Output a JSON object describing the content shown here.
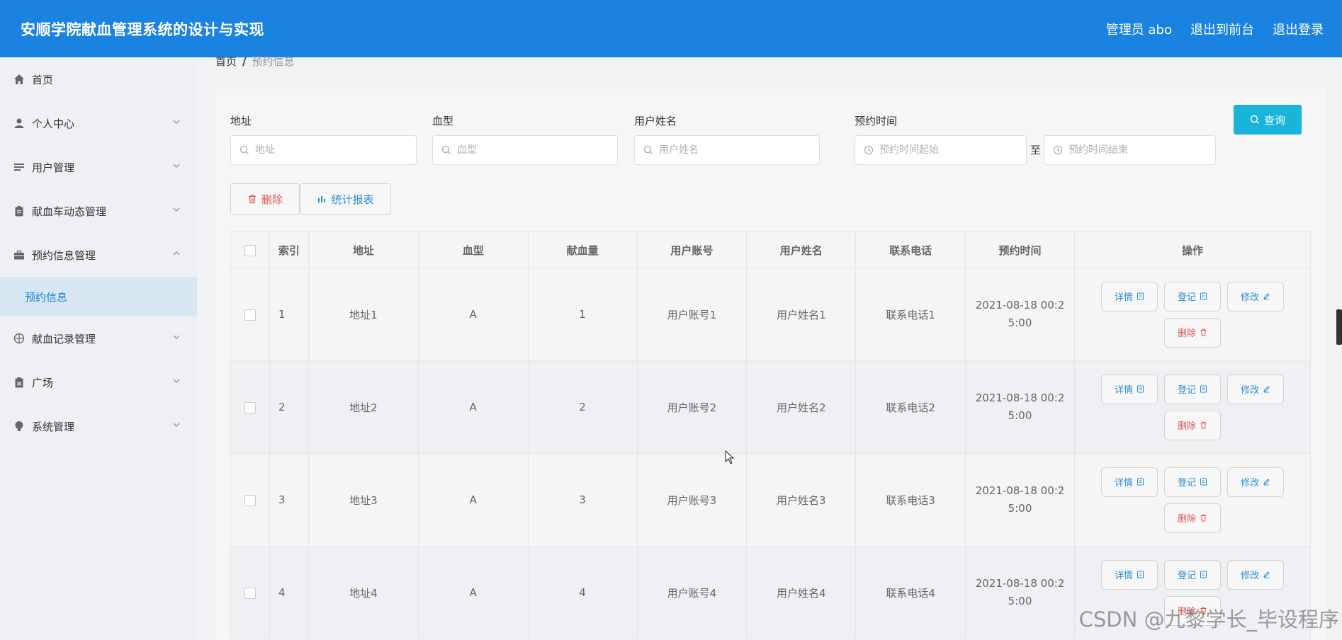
{
  "header": {
    "title": "安顺学院献血管理系统的设计与实现",
    "user": "管理员 abo",
    "to_front": "退出到前台",
    "logout": "退出登录"
  },
  "sidebar": {
    "items": [
      {
        "label": "首页",
        "icon": "home-icon"
      },
      {
        "label": "个人中心",
        "icon": "person-icon"
      },
      {
        "label": "用户管理",
        "icon": "list-icon"
      },
      {
        "label": "献血车动态管理",
        "icon": "clipboard-icon"
      },
      {
        "label": "预约信息管理",
        "icon": "briefcase-icon"
      },
      {
        "label": "献血记录管理",
        "icon": "crosshair-icon"
      },
      {
        "label": "广场",
        "icon": "clipboard-x-icon"
      },
      {
        "label": "系统管理",
        "icon": "bulb-icon"
      }
    ],
    "sub_item": "预约信息"
  },
  "breadcrumb": {
    "home": "首页",
    "sep": "/",
    "current": "预约信息"
  },
  "filters": {
    "address_label": "地址",
    "address_placeholder": "地址",
    "blood_label": "血型",
    "blood_placeholder": "血型",
    "name_label": "用户姓名",
    "name_placeholder": "用户姓名",
    "time_label": "预约时间",
    "time_start_placeholder": "预约时间起始",
    "range_sep": "至",
    "time_end_placeholder": "预约时间结束",
    "search_button": "查询"
  },
  "toolbar": {
    "delete": "删除",
    "report": "统计报表"
  },
  "table": {
    "headers": [
      "索引",
      "地址",
      "血型",
      "献血量",
      "用户账号",
      "用户姓名",
      "联系电话",
      "预约时间",
      "操作"
    ],
    "rows": [
      {
        "idx": "1",
        "address": "地址1",
        "blood": "A",
        "amount": "1",
        "account": "用户账号1",
        "name": "用户姓名1",
        "phone": "联系电话1",
        "time1": "2021-08-18 00:2",
        "time2": "5:00"
      },
      {
        "idx": "2",
        "address": "地址2",
        "blood": "A",
        "amount": "2",
        "account": "用户账号2",
        "name": "用户姓名2",
        "phone": "联系电话2",
        "time1": "2021-08-18 00:2",
        "time2": "5:00"
      },
      {
        "idx": "3",
        "address": "地址3",
        "blood": "A",
        "amount": "3",
        "account": "用户账号3",
        "name": "用户姓名3",
        "phone": "联系电话3",
        "time1": "2021-08-18 00:2",
        "time2": "5:00"
      },
      {
        "idx": "4",
        "address": "地址4",
        "blood": "A",
        "amount": "4",
        "account": "用户账号4",
        "name": "用户姓名4",
        "phone": "联系电话4",
        "time1": "2021-08-18 00:2",
        "time2": "5:00"
      }
    ],
    "ops": {
      "detail": "详情",
      "register": "登记",
      "edit": "修改",
      "delete": "删除"
    }
  },
  "watermark": "CSDN @九黎学长_毕设程序",
  "colors": {
    "header": "#1a82e0",
    "search": "#1ab4d8",
    "accent_blue": "#2a8fd5",
    "danger": "#e25555"
  }
}
